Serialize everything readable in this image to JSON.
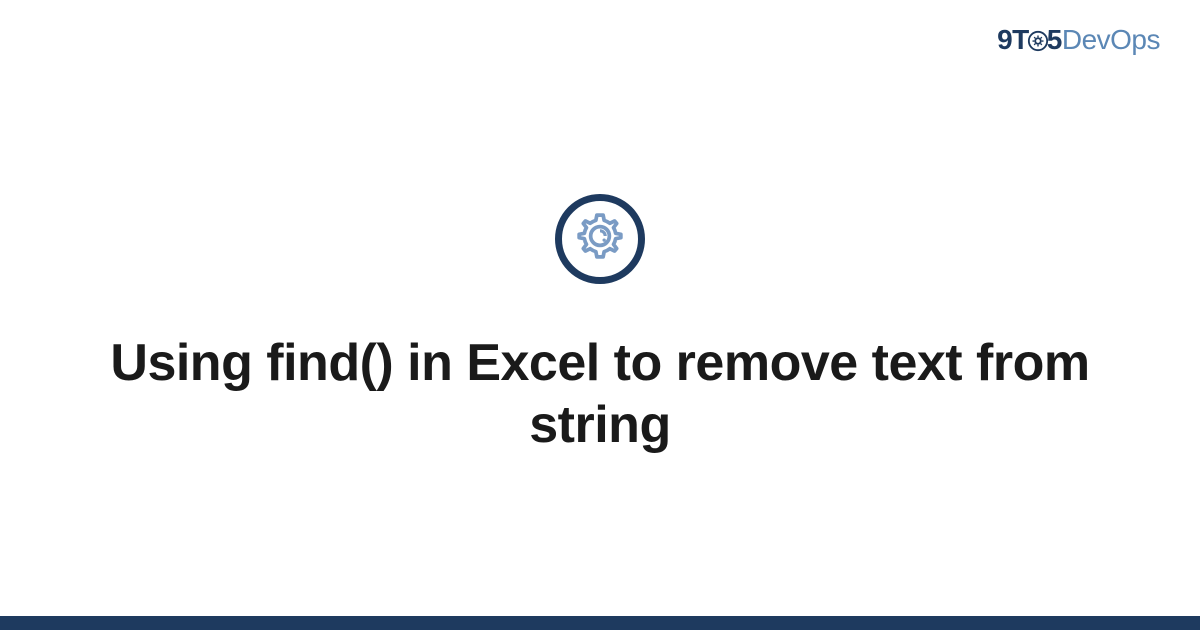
{
  "logo": {
    "part1": "9T",
    "part2": "5",
    "part3": "DevOps"
  },
  "title": "Using find() in Excel to remove text from string",
  "colors": {
    "dark_navy": "#1e3a5f",
    "light_blue": "#5b87b5",
    "icon_blue": "#7a9bc4"
  }
}
